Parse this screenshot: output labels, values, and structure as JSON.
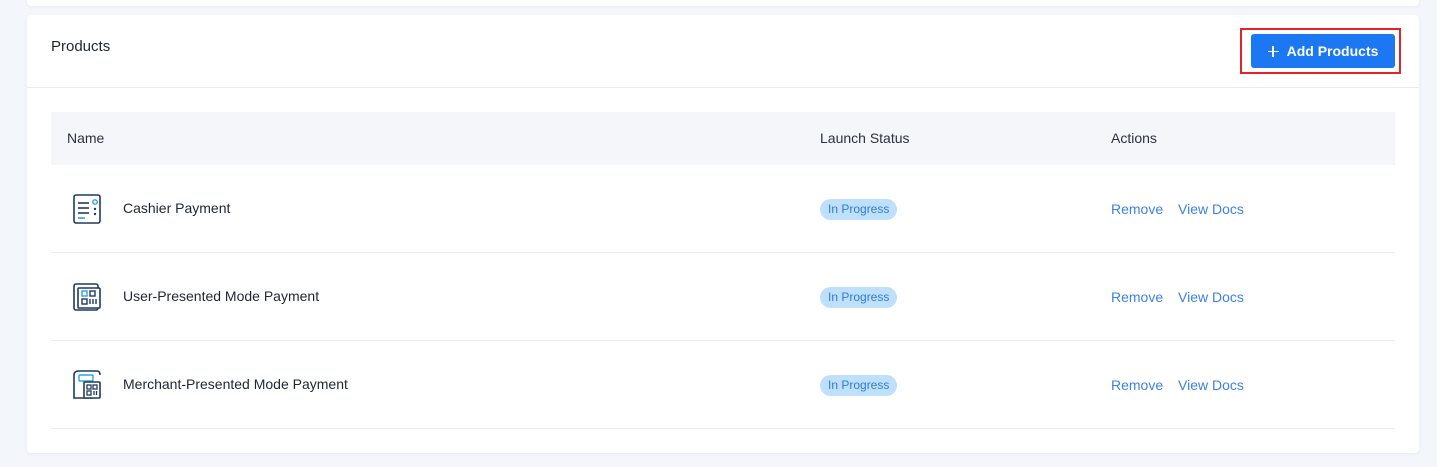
{
  "header": {
    "title": "Products",
    "add_button_label": "Add Products"
  },
  "table": {
    "columns": [
      "Name",
      "Launch Status",
      "Actions"
    ],
    "rows": [
      {
        "name": "Cashier Payment",
        "icon": "cashier-payment-icon",
        "status": "In Progress",
        "remove_label": "Remove",
        "docs_label": "View Docs"
      },
      {
        "name": "User-Presented Mode Payment",
        "icon": "user-presented-qr-icon",
        "status": "In Progress",
        "remove_label": "Remove",
        "docs_label": "View Docs"
      },
      {
        "name": "Merchant-Presented Mode Payment",
        "icon": "merchant-presented-qr-icon",
        "status": "In Progress",
        "remove_label": "Remove",
        "docs_label": "View Docs"
      }
    ]
  },
  "colors": {
    "primary": "#1b78f2",
    "link": "#3c82e6",
    "badge_bg": "#bfe0fb",
    "badge_text": "#2f7bd6",
    "highlight": "#e5222a",
    "icon_stroke": "#1f3a5f",
    "icon_accent": "#2aa3e8"
  }
}
